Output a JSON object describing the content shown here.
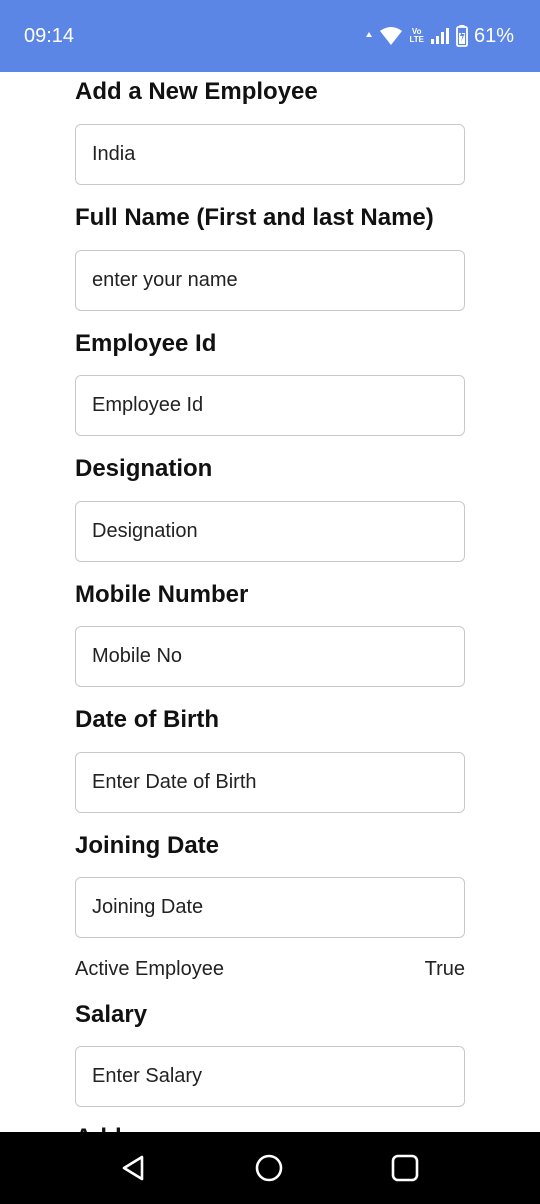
{
  "status_bar": {
    "time": "09:14",
    "battery": "61%",
    "icons": [
      "data-arrow-icon",
      "wifi-icon",
      "volte-icon",
      "signal-icon",
      "battery-icon"
    ],
    "volte_top": "Vo",
    "volte_bottom": "LTE"
  },
  "form": {
    "title": "Add a New Employee",
    "country_value": "India",
    "full_name": {
      "label": "Full Name (First and last Name)",
      "placeholder": "enter your name"
    },
    "employee_id": {
      "label": "Employee Id",
      "placeholder": "Employee Id"
    },
    "designation": {
      "label": "Designation",
      "placeholder": "Designation"
    },
    "mobile": {
      "label": "Mobile Number",
      "placeholder": "Mobile No"
    },
    "dob": {
      "label": "Date of Birth",
      "placeholder": "Enter Date of Birth"
    },
    "joining": {
      "label": "Joining Date",
      "placeholder": "Joining Date"
    },
    "active": {
      "label": "Active Employee",
      "value": "True"
    },
    "salary": {
      "label": "Salary",
      "placeholder": "Enter Salary"
    },
    "next_label_partial": "Add"
  },
  "nav_bar": {
    "icons": [
      "back-icon",
      "home-icon",
      "recents-icon"
    ]
  },
  "colors": {
    "status_bar": "#5b86e5",
    "nav_bar": "#000000",
    "input_border": "#c9c9c9"
  }
}
